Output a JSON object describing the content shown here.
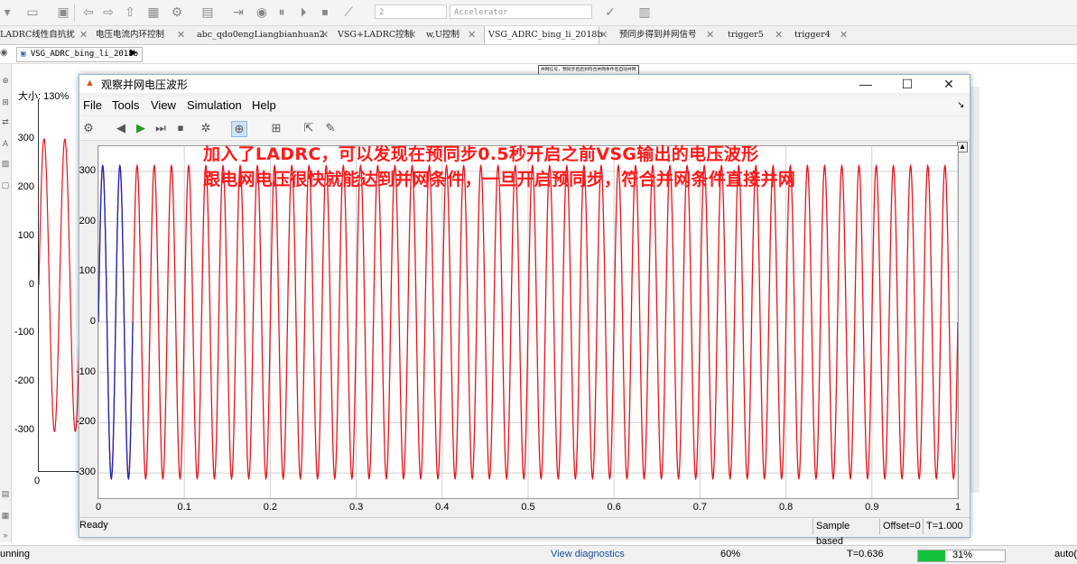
{
  "toolbar": {
    "sim_time": "2",
    "sim_mode": "Accelerator",
    "icons": [
      "run-icon",
      "open-folder-icon",
      "save-icon",
      "back-icon",
      "forward-icon",
      "up-icon",
      "library-icon",
      "settings-icon",
      "layout-icon",
      "step-icon",
      "pause-icon",
      "stop-icon",
      "scope-icon",
      "check-icon",
      "grid-icon"
    ]
  },
  "tabs": [
    {
      "label": "LADRC线性自抗扰"
    },
    {
      "label": "电压电流内环控制"
    },
    {
      "label": "abc_qdo0engLiangbianhuan2"
    },
    {
      "label": "VSG+LADRC控制"
    },
    {
      "label": "w,U控制"
    },
    {
      "label": "VSG_ADRC_bing_li_2018b"
    },
    {
      "label": "预同步得到并网信号"
    },
    {
      "label": "trigger5"
    },
    {
      "label": "trigger4"
    }
  ],
  "breadcrumb": {
    "model": "VSG_ADRC_bing_li_2018b"
  },
  "background": {
    "zoom_label": "大小: 130%",
    "yticks": [
      "300",
      "200",
      "100",
      "0",
      "-100",
      "-200",
      "-300"
    ],
    "xtick0": "0",
    "block_caption": "并网信号，预同步启启到符合并网条件后自动并网"
  },
  "scope": {
    "title": "观察并网电压波形",
    "menu": [
      "File",
      "Tools",
      "View",
      "Simulation",
      "Help"
    ],
    "status": "Ready",
    "sample_based": "Sample based",
    "offset": "Offset=0",
    "time": "T=1.000",
    "annotation_line1": "加入了LADRC，可以发现在预同步0.5秒开启之前VSG输出的电压波形",
    "annotation_line2": "跟电网电压很快就能达到并网条件，一旦开启预同步，符合并网条件直接并网",
    "colors": {
      "grid_signal": "#e8141c",
      "vsg_signal": "#1c2bb8",
      "annotation": "#ff1a1a"
    }
  },
  "chart_data": {
    "type": "line",
    "title": "",
    "xlabel": "",
    "ylabel": "",
    "xlim": [
      0,
      1
    ],
    "ylim": [
      -350,
      350
    ],
    "xticks": [
      "0",
      "0.1",
      "0.2",
      "0.3",
      "0.4",
      "0.5",
      "0.6",
      "0.7",
      "0.8",
      "0.9",
      "1"
    ],
    "yticks": [
      "300",
      "200",
      "100",
      "0",
      "-100",
      "-200",
      "-300"
    ],
    "grid": true,
    "series": [
      {
        "color": "#e8141c",
        "amplitude": 311,
        "frequency_hz": 50,
        "x_start": 0,
        "x_end": 1
      },
      {
        "color": "#1c2bb8",
        "amplitude": 311,
        "frequency_hz": 50,
        "x_start": 0,
        "x_end": 0.04
      }
    ]
  },
  "main_status": {
    "state": "unning",
    "diagnostics": "View diagnostics",
    "zoom": "60%",
    "time": "T=0.636",
    "progress_pct": 31,
    "progress_label": "31%",
    "solver": "auto("
  }
}
